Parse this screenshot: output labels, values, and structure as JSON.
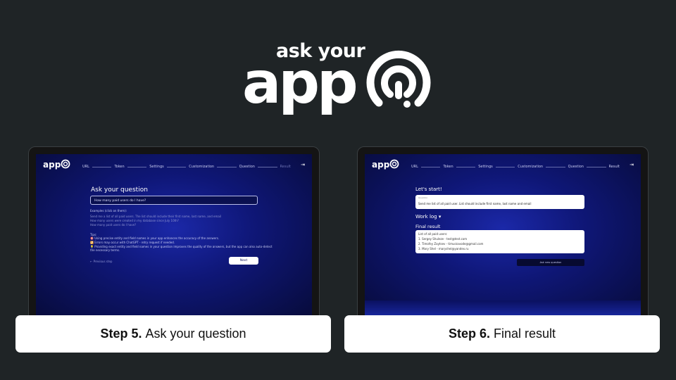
{
  "logo": {
    "line1": "ask your",
    "line2": "app"
  },
  "app_logo": "app",
  "stepper": {
    "steps": [
      "URL",
      "Token",
      "Settings",
      "Customization",
      "Question",
      "Result"
    ]
  },
  "logout_icon": "logout-icon",
  "screen5": {
    "title": "Ask your question",
    "input_value": "How many paid users do I have?",
    "examples_heading": "Examples (click on them):",
    "examples": [
      "Send me a list of all paid users. The list should include their first name, last name, and email",
      "How many users were created in my database since July 10th?",
      "How many paid users do I have?"
    ],
    "tips_heading": "Tips:",
    "tips": [
      "🎯 Using precise entity and field names in your app enhances the accuracy of the answers.",
      "🔁 Errors may occur with ChatGPT - retry request if needed.",
      "💡 Providing exact entity and field names in your question improves the quality of the answers, but the app can also auto-detect",
      "the necessary terms."
    ],
    "prev_label": "← Previous step",
    "next_label": "Next"
  },
  "screen6": {
    "title": "Let's start!",
    "question_label": "Question",
    "question_value": "Send me list of all paid user. List should include first name, last name and email",
    "worklog_label": "Work log ▾",
    "final_title": "Final result",
    "result_lines": [
      "List of all paid users:",
      "1. Sergey Shuleze - test@test.com",
      "2. Timofey Zaytsev - timurzavode@gmail.com",
      "3. Mary Shel - maryshel@yandex.ru"
    ],
    "ask_new_label": "Ask new question"
  },
  "captions": [
    {
      "bold": "Step 5.",
      "text": "Ask your question"
    },
    {
      "bold": "Step 6.",
      "text": "Final result"
    }
  ]
}
